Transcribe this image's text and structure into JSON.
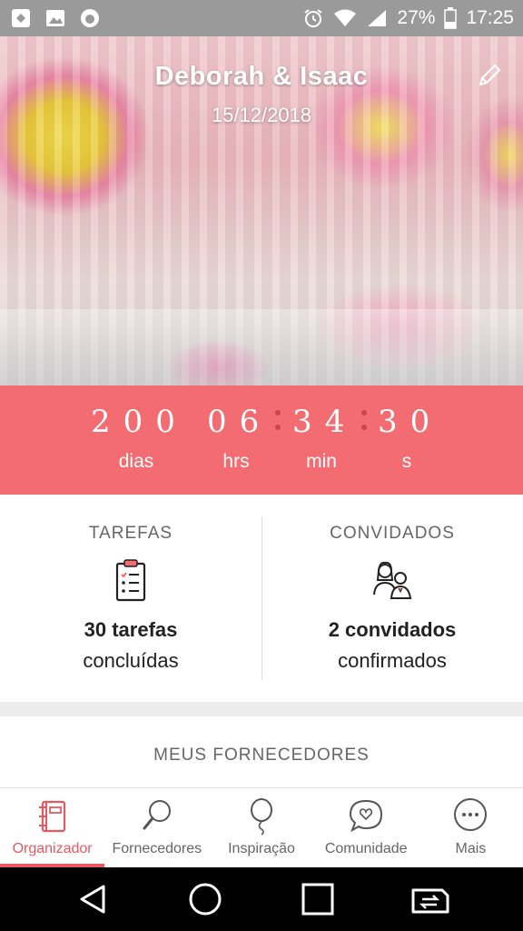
{
  "status_bar": {
    "battery": "27%",
    "time": "17:25",
    "icons": [
      "app-icon",
      "gallery-icon",
      "lion-app-icon",
      "alarm-icon",
      "wifi-icon",
      "signal-4g-icon",
      "battery-icon"
    ]
  },
  "hero": {
    "couple": "Deborah & Isaac",
    "date": "15/12/2018",
    "edit_icon": "pencil-icon"
  },
  "countdown": {
    "days": "200",
    "days_label": "dias",
    "hours": "06",
    "hours_label": "hrs",
    "minutes": "34",
    "minutes_label": "min",
    "seconds": "30",
    "seconds_label": "s"
  },
  "stats": {
    "tasks": {
      "title": "TAREFAS",
      "icon": "clipboard-checklist-icon",
      "value": "30 tarefas",
      "caption": "concluídas"
    },
    "guests": {
      "title": "CONVIDADOS",
      "icon": "guests-couple-icon",
      "value": "2 convidados",
      "caption": "confirmados"
    }
  },
  "providers": {
    "title": "MEUS FORNECEDORES"
  },
  "bottom_nav": {
    "items": [
      {
        "label": "Organizador",
        "icon": "notebook-icon",
        "active": true
      },
      {
        "label": "Fornecedores",
        "icon": "search-magnifier-icon",
        "active": false
      },
      {
        "label": "Inspiração",
        "icon": "balloon-icon",
        "active": false
      },
      {
        "label": "Comunidade",
        "icon": "chat-heart-icon",
        "active": false
      },
      {
        "label": "Mais",
        "icon": "more-dots-icon",
        "active": false
      }
    ]
  },
  "colors": {
    "accent": "#f26c72",
    "active_nav": "#e85860",
    "status_bar": "#9a9a9a"
  }
}
